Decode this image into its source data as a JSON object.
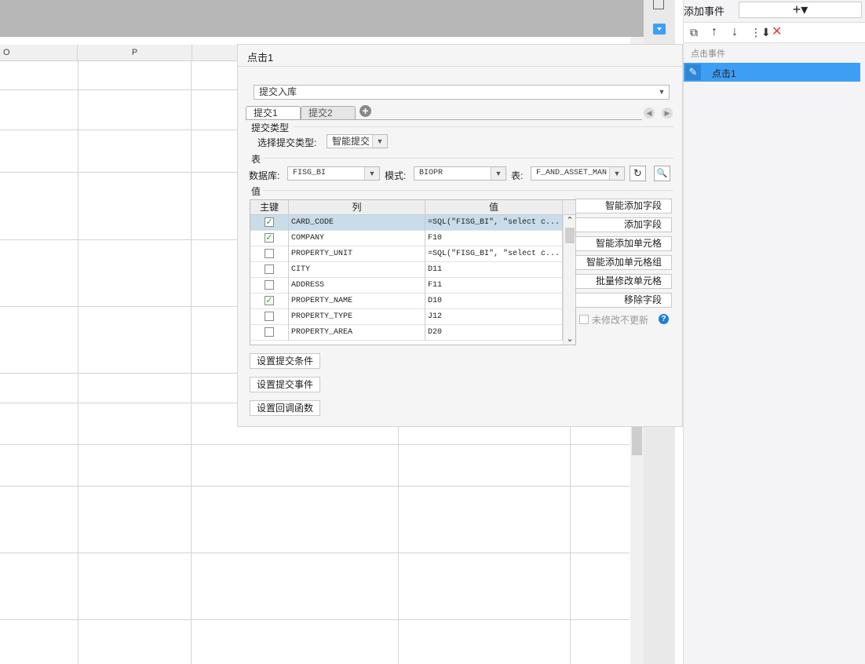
{
  "sheet": {
    "columns": [
      "O",
      "P"
    ]
  },
  "right_panel": {
    "title": "添加事件",
    "add_symbol": "+▾",
    "section_label": "点击事件",
    "event_item": "点击1"
  },
  "dialog": {
    "title": "点击1",
    "action_select": "提交入库",
    "tabs": [
      "提交1",
      "提交2"
    ],
    "submit_type_section": "提交类型",
    "submit_type_label": "选择提交类型:",
    "submit_type_value": "智能提交",
    "table_section": "表",
    "db_label": "数据库:",
    "db_value": "FISG_BI",
    "schema_label": "模式:",
    "schema_value": "BIOPR",
    "table_label": "表:",
    "table_value": "F_AND_ASSET_MAN",
    "value_section": "值",
    "grid_headers": {
      "key": "主键",
      "column": "列",
      "value": "值"
    },
    "rows": [
      {
        "checked": true,
        "column": "CARD_CODE",
        "value": "=SQL(\"FISG_BI\", \"select c..."
      },
      {
        "checked": true,
        "column": "COMPANY",
        "value": "F10"
      },
      {
        "checked": false,
        "column": "PROPERTY_UNIT",
        "value": "=SQL(\"FISG_BI\", \"select c..."
      },
      {
        "checked": false,
        "column": "CITY",
        "value": "D11"
      },
      {
        "checked": false,
        "column": "ADDRESS",
        "value": "F11"
      },
      {
        "checked": true,
        "column": "PROPERTY_NAME",
        "value": "D10"
      },
      {
        "checked": false,
        "column": "PROPERTY_TYPE",
        "value": "J12"
      },
      {
        "checked": false,
        "column": "PROPERTY_AREA",
        "value": "D20"
      }
    ],
    "side_buttons": [
      "智能添加字段",
      "添加字段",
      "智能添加单元格",
      "智能添加单元格组",
      "批量修改单元格",
      "移除字段"
    ],
    "no_update_label": "未修改不更新",
    "bottom_buttons": [
      "设置提交条件",
      "设置提交事件",
      "设置回调函数"
    ]
  },
  "colors": {
    "accent": "#3e9ef4",
    "selected_row": "#c8dcea",
    "delete": "#e53935"
  }
}
